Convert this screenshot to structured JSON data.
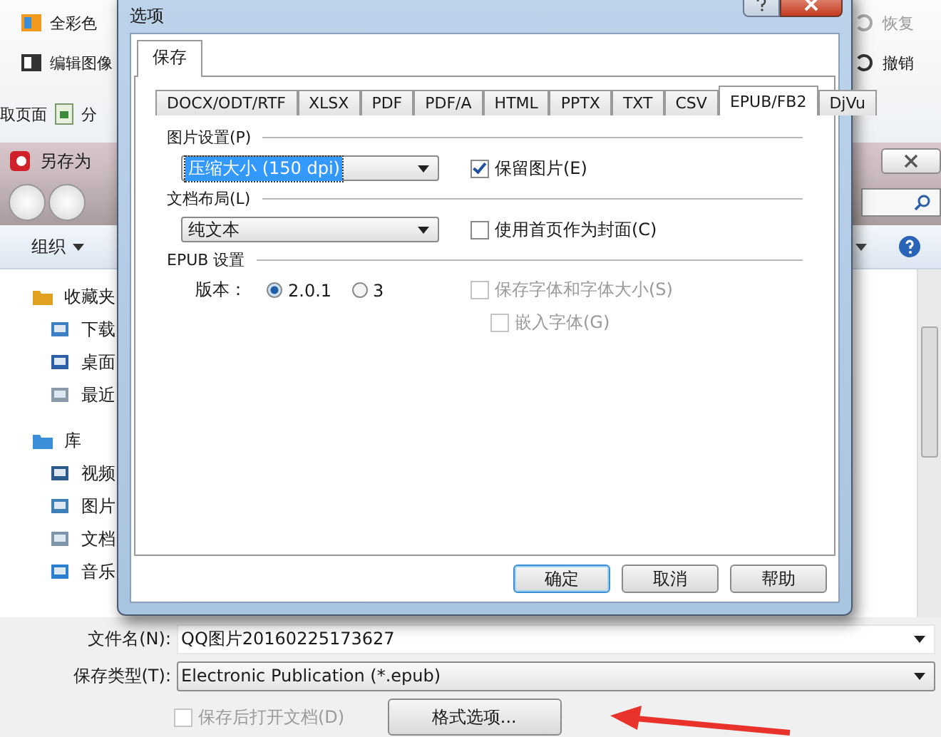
{
  "background_app": {
    "toolbar_left": [
      {
        "label": "全彩色"
      },
      {
        "label": "编辑图像"
      }
    ],
    "toolbar_row": [
      {
        "label": "取页面"
      },
      {
        "label": "分"
      }
    ],
    "toolbar_right": [
      {
        "label": "恢复"
      },
      {
        "label": "撤销"
      }
    ]
  },
  "save_dialog": {
    "title": "另存为",
    "organize": "组织",
    "nav_tree": [
      {
        "label": "收藏夹",
        "children": [
          {
            "label": "下载"
          },
          {
            "label": "桌面"
          },
          {
            "label": "最近"
          }
        ]
      },
      {
        "label": "库",
        "children": [
          {
            "label": "视频"
          },
          {
            "label": "图片"
          },
          {
            "label": "文档"
          },
          {
            "label": "音乐"
          }
        ]
      }
    ],
    "file_name": {
      "label": "文件名(N):",
      "value": "QQ图片20160225173627"
    },
    "file_type": {
      "label": "保存类型(T):",
      "value": "Electronic Publication (*.epub)"
    },
    "open_after_save": {
      "label": "保存后打开文档(D)",
      "checked": false,
      "disabled": true
    },
    "format_button": "格式选项..."
  },
  "options_dialog": {
    "title": "选项",
    "outer_tabs": [
      {
        "label": "保存",
        "selected": true
      }
    ],
    "format_tabs": [
      {
        "label": "DOCX/ODT/RTF",
        "selected": false
      },
      {
        "label": "XLSX",
        "selected": false
      },
      {
        "label": "PDF",
        "selected": false
      },
      {
        "label": "PDF/A",
        "selected": false
      },
      {
        "label": "HTML",
        "selected": false
      },
      {
        "label": "PPTX",
        "selected": false
      },
      {
        "label": "TXT",
        "selected": false
      },
      {
        "label": "CSV",
        "selected": false
      },
      {
        "label": "EPUB/FB2",
        "selected": true
      },
      {
        "label": "DjVu",
        "selected": false
      }
    ],
    "image_settings": {
      "heading": "图片设置(P)",
      "select": "压缩大小 (150 dpi)",
      "focused": true,
      "checkbox": {
        "label": "保留图片(E)",
        "checked": true,
        "disabled": false
      }
    },
    "layout": {
      "heading": "文档布局(L)",
      "select": "纯文本",
      "focused": false,
      "checkbox": {
        "label": "使用首页作为封面(C)",
        "checked": false,
        "disabled": false
      }
    },
    "epub": {
      "heading": "EPUB 设置",
      "version_label": "版本：",
      "versions": [
        {
          "label": "2.0.1",
          "selected": true
        },
        {
          "label": "3",
          "selected": false
        }
      ],
      "save_fonts": {
        "label": "保存字体和字体大小(S)",
        "checked": false,
        "disabled": true
      },
      "embed_fonts": {
        "label": "嵌入字体(G)",
        "checked": false,
        "disabled": true
      }
    },
    "buttons": [
      {
        "label": "确定",
        "default": true
      },
      {
        "label": "取消",
        "default": false
      },
      {
        "label": "帮助",
        "default": false
      }
    ]
  }
}
